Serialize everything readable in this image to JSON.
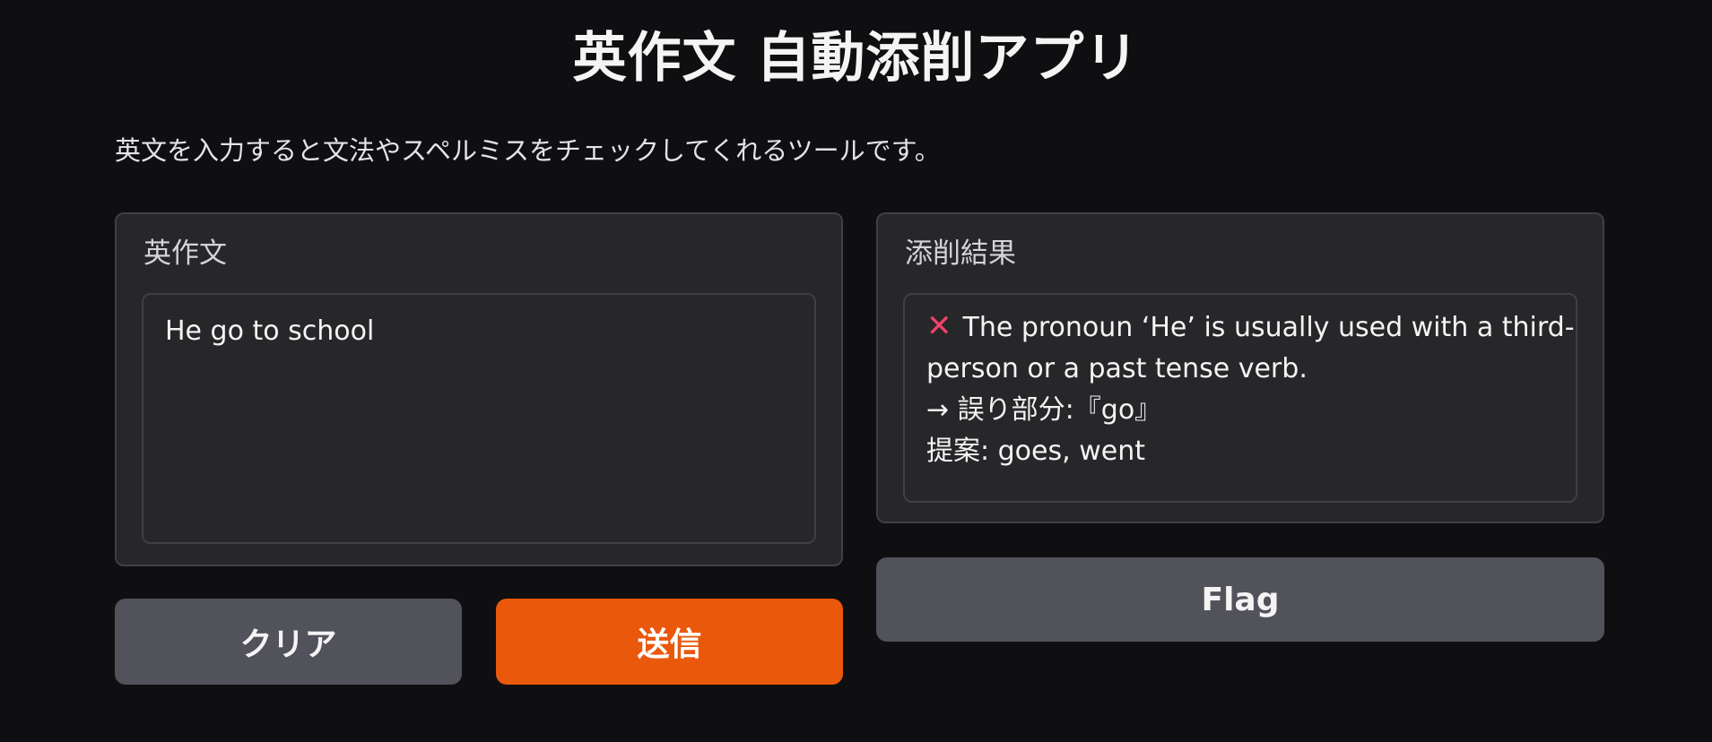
{
  "app": {
    "title": "英作文 自動添削アプリ",
    "description": "英文を入力すると文法やスペルミスをチェックしてくれるツールです。"
  },
  "input_panel": {
    "label": "英作文",
    "value": "He go to school"
  },
  "output_panel": {
    "label": "添削結果",
    "status_icon": "cross-mark-icon",
    "lines": [
      "The pronoun ‘He’ is usually used with a third-",
      "person or a past tense verb.",
      "→ 誤り部分:『go』",
      "提案: goes, went"
    ]
  },
  "buttons": {
    "clear_label": "クリア",
    "submit_label": "送信",
    "flag_label": "Flag"
  },
  "colors": {
    "background": "#0f0f11",
    "panel": "#27272a",
    "primary": "#ea580c",
    "secondary": "#52525b",
    "error": "#f0426b"
  }
}
